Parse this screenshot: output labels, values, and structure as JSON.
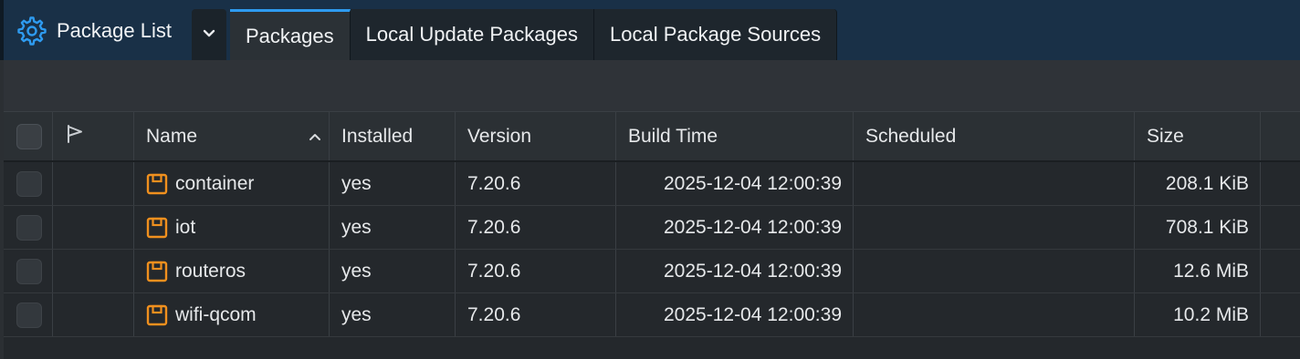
{
  "app": {
    "title": "Package List"
  },
  "tabs": [
    {
      "label": "Packages",
      "active": true
    },
    {
      "label": "Local Update Packages",
      "active": false
    },
    {
      "label": "Local Package Sources",
      "active": false
    }
  ],
  "table": {
    "columns": [
      "",
      "",
      "Name",
      "Installed",
      "Version",
      "Build Time",
      "Scheduled",
      "Size"
    ],
    "sort": {
      "column": "Name",
      "direction": "asc"
    },
    "rows": [
      {
        "name": "container",
        "installed": "yes",
        "version": "7.20.6",
        "build_time": "2025-12-04 12:00:39",
        "scheduled": "",
        "size": "208.1 KiB"
      },
      {
        "name": "iot",
        "installed": "yes",
        "version": "7.20.6",
        "build_time": "2025-12-04 12:00:39",
        "scheduled": "",
        "size": "708.1 KiB"
      },
      {
        "name": "routeros",
        "installed": "yes",
        "version": "7.20.6",
        "build_time": "2025-12-04 12:00:39",
        "scheduled": "",
        "size": "12.6 MiB"
      },
      {
        "name": "wifi-qcom",
        "installed": "yes",
        "version": "7.20.6",
        "build_time": "2025-12-04 12:00:39",
        "scheduled": "",
        "size": "10.2 MiB"
      }
    ]
  },
  "icons": {
    "app": "gear-icon",
    "dropdown": "chevron-down-icon",
    "flag_column": "flag-icon",
    "sort": "chevron-up-icon",
    "package": "package-icon"
  },
  "colors": {
    "accent": "#2e9bf0",
    "package_icon": "#f0901e",
    "header_bg": "#193047"
  }
}
